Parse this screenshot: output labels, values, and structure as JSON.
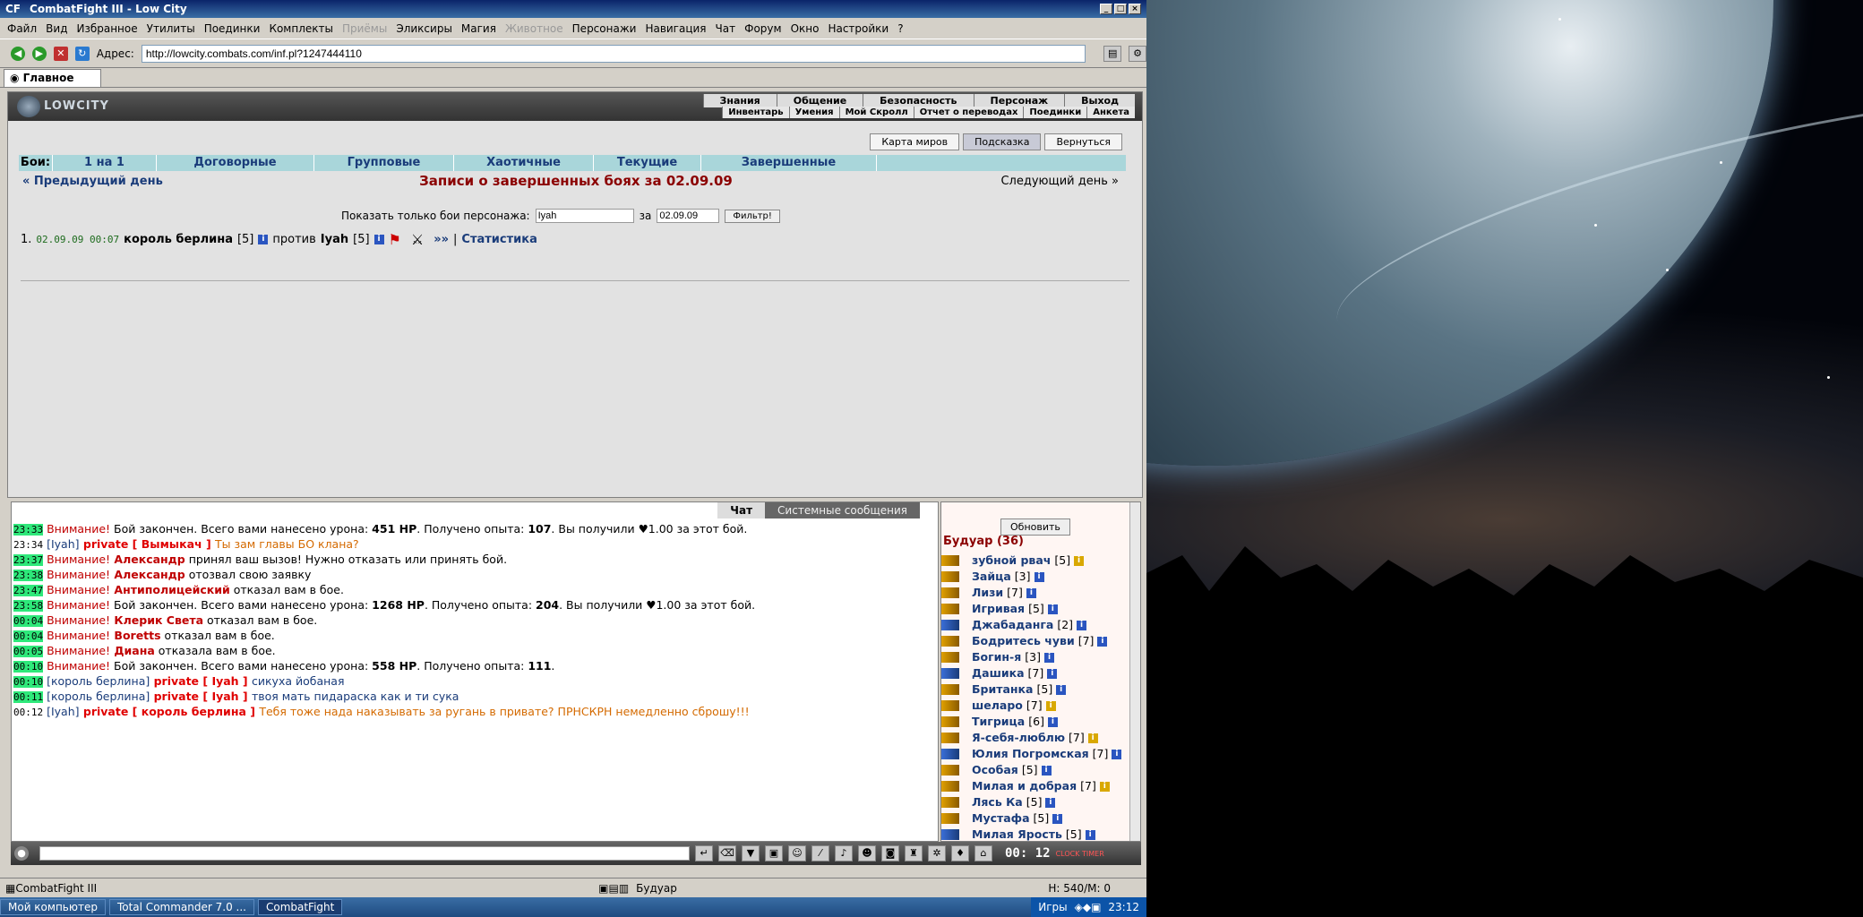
{
  "window": {
    "title": "CombatFight III - Low City",
    "app_badge": "CF"
  },
  "menu": [
    "Файл",
    "Вид",
    "Избранное",
    "Утилиты",
    "Поединки",
    "Комплекты",
    "Приёмы",
    "Эликсиры",
    "Магия",
    "Животное",
    "Персонажи",
    "Навигация",
    "Чат",
    "Форум",
    "Окно",
    "Настройки",
    "?"
  ],
  "menu_disabled": [
    "Приёмы",
    "Животное"
  ],
  "address": {
    "label": "Адрес:",
    "url": "http://lowcity.combats.com/inf.pl?1247444110"
  },
  "browser_tab": "Главное",
  "game": {
    "logo": "LOWCITY",
    "nav_top": [
      "Знания",
      "Общение",
      "Безопасность",
      "Персонаж",
      "Выход"
    ],
    "nav_bottom": [
      "Инвентарь",
      "Умения",
      "Мой Скролл",
      "Отчет о переводах",
      "Поединки",
      "Анкета"
    ],
    "top_buttons": [
      "Карта миров",
      "Подсказка",
      "Вернуться"
    ],
    "fights_label": "Бои:",
    "fight_tabs": [
      "1 на 1",
      "Договорные",
      "Групповые",
      "Хаотичные",
      "Текущие",
      "Завершенные"
    ],
    "prev_day": "« Предыдущий день",
    "next_day": "Следующий день »",
    "page_title": "Записи о завершенных боях за 02.09.09",
    "filter_label": "Показать только бои персонажа:",
    "filter_name": "Iyah",
    "filter_for": "за",
    "filter_date": "02.09.09",
    "filter_button": "Фильтр!",
    "fight": {
      "num": "1.",
      "datetime": "02.09.09 00:07",
      "p1": "король берлина",
      "p1_level": "[5]",
      "vs": "против",
      "p2": "Iyah",
      "p2_level": "[5]",
      "more": "»»",
      "stats": "Статистика"
    }
  },
  "chat": {
    "tab_chat": "Чат",
    "tab_system": "Системные сообщения",
    "lines": [
      {
        "t": "23:33",
        "g": true,
        "a": "Внимание!",
        "b": " Бой закончен. Всего вами нанесено урона: ",
        "c": "451 HP",
        ".": ". Получено опыта: ",
        "d": "107",
        "e": ". Вы получили ♥1.00 за этот бой."
      },
      {
        "t": "23:34",
        "g": false,
        "a": "[Iyah]",
        "b": " private [ Вымыкач ] ",
        "c": "",
        "d": "",
        "e": "Ты зам главы БО клана?"
      },
      {
        "t": "23:37",
        "g": true,
        "a": "Внимание!",
        "b": " Александр",
        "c": "",
        "d": "",
        "e": " принял ваш вызов! Нужно отказать или принять бой."
      },
      {
        "t": "23:38",
        "g": true,
        "a": "Внимание!",
        "b": " Александр",
        "c": "",
        "d": "",
        "e": " отозвал свою заявку"
      },
      {
        "t": "23:47",
        "g": true,
        "a": "Внимание!",
        "b": " Антиполицейский",
        "c": "",
        "d": "",
        "e": " отказал вам в бое."
      },
      {
        "t": "23:58",
        "g": true,
        "a": "Внимание!",
        "b": " Бой закончен. Всего вами нанесено урона: ",
        "c": "1268 HP",
        ".": ". Получено опыта: ",
        "d": "204",
        "e": ". Вы получили ♥1.00 за этот бой."
      },
      {
        "t": "00:04",
        "g": true,
        "a": "Внимание!",
        "b": " Клерик Света",
        "c": "",
        "d": "",
        "e": " отказал вам в бое."
      },
      {
        "t": "00:04",
        "g": true,
        "a": "Внимание!",
        "b": " Boretts",
        "c": "",
        "d": "",
        "e": " отказал вам в бое."
      },
      {
        "t": "00:05",
        "g": true,
        "a": "Внимание!",
        "b": " Диана",
        "c": "",
        "d": "",
        "e": " отказала вам в бое."
      },
      {
        "t": "00:10",
        "g": true,
        "a": "Внимание!",
        "b": " Бой закончен. Всего вами нанесено урона: ",
        "c": "558 HP",
        ".": ". Получено опыта: ",
        "d": "111",
        "e": "."
      },
      {
        "t": "00:10",
        "g": true,
        "a": "[король берлина]",
        "b": " private [ Iyah ] ",
        "c": "",
        "d": "",
        "e": "сикуха йобаная"
      },
      {
        "t": "00:11",
        "g": true,
        "a": "[король берлина]",
        "b": " private [ Iyah ] ",
        "c": "",
        "d": "",
        "e": "твоя мать пидараска как и ти сука"
      },
      {
        "t": "00:12",
        "g": false,
        "a": "[Iyah]",
        "b": " private [ король берлина ] ",
        "c": "",
        "d": "",
        "e": "Тебя тоже нада наказывать за ругань в привате? ПРНСКРН немедленно сброшу!!!"
      }
    ]
  },
  "room": {
    "refresh": "Обновить",
    "title": "Будуар (36)",
    "users": [
      {
        "n": "зубной рвач",
        "l": "[5]",
        "b": "y"
      },
      {
        "n": "Зайца",
        "l": "[3]",
        "b": "b"
      },
      {
        "n": "Лизи",
        "l": "[7]",
        "b": "b"
      },
      {
        "n": "Игривая",
        "l": "[5]",
        "b": "b"
      },
      {
        "n": "Джабаданга",
        "l": "[2]",
        "b": "b"
      },
      {
        "n": "Бодритесь чуви",
        "l": "[7]",
        "b": "b"
      },
      {
        "n": "Богин-я",
        "l": "[3]",
        "b": "b"
      },
      {
        "n": "Дашика",
        "l": "[7]",
        "b": "b"
      },
      {
        "n": "Британка",
        "l": "[5]",
        "b": "b"
      },
      {
        "n": "шеларо",
        "l": "[7]",
        "b": "y"
      },
      {
        "n": "Тигрица",
        "l": "[6]",
        "b": "b"
      },
      {
        "n": "Я-себя-люблю",
        "l": "[7]",
        "b": "y"
      },
      {
        "n": "Юлия Погромская",
        "l": "[7]",
        "b": "b"
      },
      {
        "n": "Особая",
        "l": "[5]",
        "b": "b"
      },
      {
        "n": "Милая и добрая",
        "l": "[7]",
        "b": "y"
      },
      {
        "n": "Лясь Ка",
        "l": "[5]",
        "b": "b"
      },
      {
        "n": "Мустафа",
        "l": "[5]",
        "b": "b"
      },
      {
        "n": "Милая Ярость",
        "l": "[5]",
        "b": "b"
      }
    ]
  },
  "clock": "00: 12",
  "clock_labels": "CLOCK TIMER",
  "status": {
    "app": "CombatFight III",
    "room": "Будуар",
    "hp": "H: 540/M: 0"
  },
  "taskbar": {
    "tasks": [
      "Мой компьютер",
      "Total Commander 7.0 ...",
      "CombatFight"
    ],
    "tray_label": "Игры",
    "time": "23:12"
  }
}
